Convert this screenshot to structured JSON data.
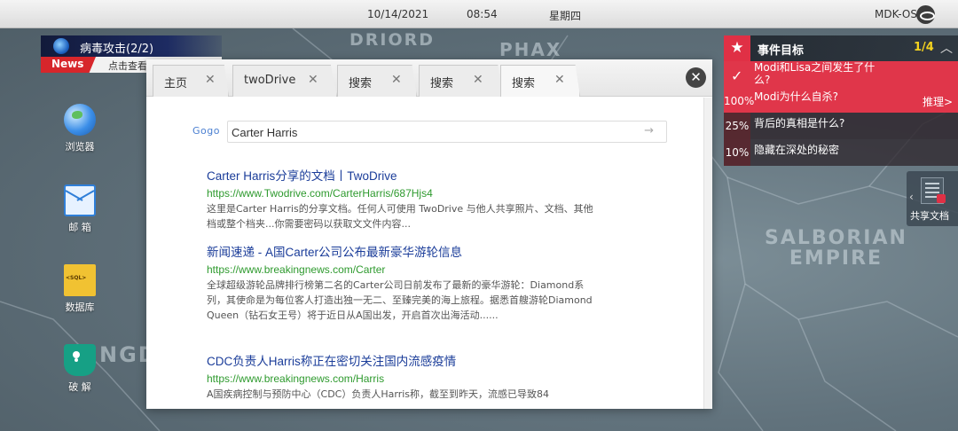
{
  "statusbar": {
    "date": "10/14/2021",
    "time": "08:54",
    "weekday": "星期四",
    "os_name": "MDK-OS"
  },
  "map_labels": {
    "driord": "DRIORD",
    "phax": "PHAX",
    "salborian": "SALBORIAN",
    "empire": "EMPIRE",
    "gd": "NGD"
  },
  "news": {
    "title": "病毒攻击(2/2)",
    "tag": "News",
    "subtitle": "点击查看"
  },
  "desktop_icons": [
    {
      "label": "浏览器",
      "icon": "globe-icon"
    },
    {
      "label": "邮 箱",
      "icon": "mail-icon"
    },
    {
      "label": "数据库",
      "icon": "database-file-icon"
    },
    {
      "label": "破 解",
      "icon": "shield-icon"
    }
  ],
  "browser": {
    "tabs": [
      {
        "label": "主页"
      },
      {
        "label": "twoDrive"
      },
      {
        "label": "搜索"
      },
      {
        "label": "搜索"
      },
      {
        "label": "搜索"
      }
    ],
    "close_symbol": "✕",
    "tab_close_symbol": "✕",
    "search": {
      "logo": "Gogo",
      "query": "Carter Harris"
    },
    "results": [
      {
        "title": "Carter Harris分享的文档丨TwoDrive",
        "url": "https://www.Twodrive.com/CarterHarris/687Hjs4",
        "desc": "这里是Carter Harris的分享文档。任何人可使用 TwoDrive 与他人共享照片、文档、其他档或整个档夹...你需要密码以获取文文件内容..."
      },
      {
        "title": "新闻速递 - A国Carter公司公布最新豪华游轮信息",
        "url": "https://www.breakingnews.com/Carter",
        "desc": "全球超级游轮品牌排行榜第二名的Carter公司日前发布了最新的豪华游轮：Diamond系列，其使命是为每位客人打造出独一无二、至臻完美的海上旅程。据悉首艘游轮Diamond Queen（钻石女王号）将于近日从A国出发，开启首次出海活动......"
      },
      {
        "title": "CDC负责人Harris称正在密切关注国内流感疫情",
        "url": "https://www.breakingnews.com/Harris",
        "desc": "A国疾病控制与预防中心（CDC）负责人Harris称，截至到昨天，流感已导致84"
      }
    ]
  },
  "events": {
    "title": "事件目标",
    "count": "1/4",
    "items": [
      {
        "question": "Modi和Lisa之间发生了什么?",
        "percent": "",
        "done": true
      },
      {
        "question": "Modi为什么自杀?",
        "percent": "100%",
        "action": "推理>"
      },
      {
        "question": "背后的真相是什么?",
        "percent": "25%"
      },
      {
        "question": "隐藏在深处的秘密",
        "percent": "10%"
      }
    ]
  },
  "shared_docs": {
    "label": "共享文档"
  },
  "colors": {
    "accent_red": "#e0364a",
    "link_blue": "#1a3c99",
    "url_green": "#2e9a2e",
    "count_yellow": "#f4d21f"
  }
}
